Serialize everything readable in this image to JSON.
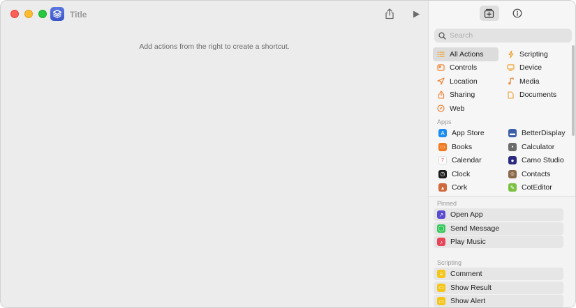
{
  "window": {
    "title": "Title",
    "empty_message": "Add actions from the right to create a shortcut."
  },
  "toolbar": {
    "share_icon": "share-icon",
    "run_icon": "play-icon"
  },
  "sidebar": {
    "search_placeholder": "Search",
    "categories": [
      {
        "label": "All Actions",
        "icon": "list-icon",
        "color": "#f0a030",
        "selected": true
      },
      {
        "label": "Scripting",
        "icon": "scripting-icon",
        "color": "#f0a030"
      },
      {
        "label": "Controls",
        "icon": "controls-icon",
        "color": "#f08030"
      },
      {
        "label": "Device",
        "icon": "device-icon",
        "color": "#f0a030"
      },
      {
        "label": "Location",
        "icon": "location-icon",
        "color": "#f08030"
      },
      {
        "label": "Media",
        "icon": "media-icon",
        "color": "#f08030"
      },
      {
        "label": "Sharing",
        "icon": "sharing-icon",
        "color": "#f08030"
      },
      {
        "label": "Documents",
        "icon": "documents-icon",
        "color": "#f0a030"
      },
      {
        "label": "Web",
        "icon": "web-icon",
        "color": "#f08030"
      }
    ],
    "apps_label": "Apps",
    "apps": [
      {
        "label": "App Store",
        "icon": "app-store-icon",
        "color": "#1a8cf0"
      },
      {
        "label": "BetterDisplay",
        "icon": "betterdisplay-icon",
        "color": "#3a5fa8"
      },
      {
        "label": "Books",
        "icon": "books-icon",
        "color": "#f07a20"
      },
      {
        "label": "Calculator",
        "icon": "calculator-icon",
        "color": "#6b6b6b"
      },
      {
        "label": "Calendar",
        "icon": "calendar-icon",
        "color": "#ffffff"
      },
      {
        "label": "Camo Studio",
        "icon": "camo-studio-icon",
        "color": "#2a2a80"
      },
      {
        "label": "Clock",
        "icon": "clock-icon",
        "color": "#1c1c1c"
      },
      {
        "label": "Contacts",
        "icon": "contacts-icon",
        "color": "#8a6a4a"
      },
      {
        "label": "Cork",
        "icon": "cork-icon",
        "color": "#d06a3a"
      },
      {
        "label": "CotEditor",
        "icon": "coteditor-icon",
        "color": "#7cc040"
      }
    ],
    "pinned_label": "Pinned",
    "pinned": [
      {
        "label": "Open App",
        "icon": "open-app-icon",
        "color": "#5a4ad0"
      },
      {
        "label": "Send Message",
        "icon": "send-message-icon",
        "color": "#34c759"
      },
      {
        "label": "Play Music",
        "icon": "play-music-icon",
        "color": "#e8445a"
      }
    ],
    "scripting_label": "Scripting",
    "scripting": [
      {
        "label": "Comment",
        "icon": "comment-icon",
        "color": "#f5c518"
      },
      {
        "label": "Show Result",
        "icon": "show-result-icon",
        "color": "#f5c518"
      },
      {
        "label": "Show Alert",
        "icon": "show-alert-icon",
        "color": "#f5c518"
      }
    ]
  }
}
